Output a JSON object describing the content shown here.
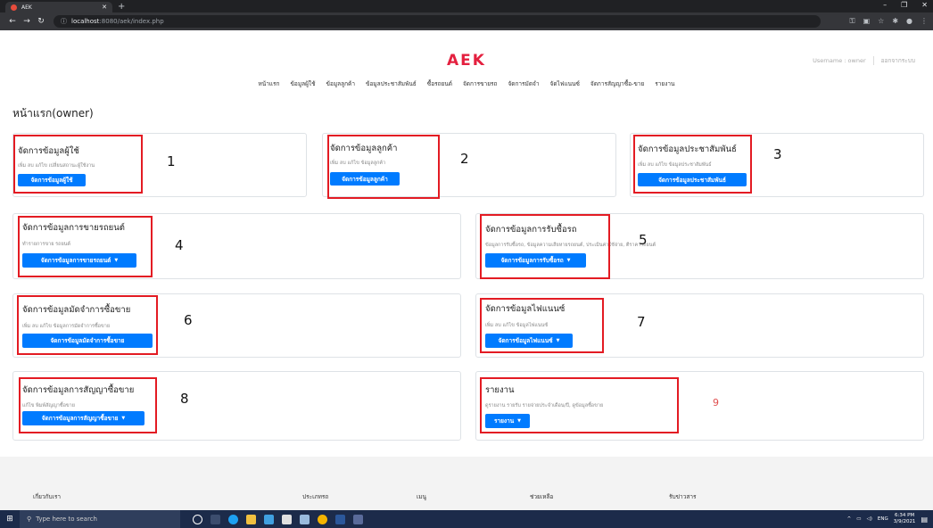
{
  "browser": {
    "tab_title": "AEK",
    "url_host": "localhost",
    "url_rest": ":8080/aek/index.php"
  },
  "header": {
    "brand": "AEK",
    "username": "Username : owner",
    "logout": "ออกจากระบบ"
  },
  "nav": [
    "หน้าแรก",
    "ข้อมูลผู้ใช้",
    "ข้อมูลลูกค้า",
    "ข้อมูลประชาสัมพันธ์",
    "ซื้อรถยนต์",
    "จัดการขายรถ",
    "จัดการมัดจำ",
    "จัดไฟแนนซ์",
    "จัดการสัญญาซื้อ-ขาย",
    "รายงาน"
  ],
  "page_title": "หน้าแรก(owner)",
  "cards": [
    {
      "title": "จัดการข้อมูลผู้ใช้",
      "desc": "เพิ่ม ลบ แก้ไข เปลี่ยนสถานะผู้ใช้งาน",
      "button": "จัดการข้อมูลผู้ใช้",
      "num": "1"
    },
    {
      "title": "จัดการข้อมูลลูกค้า",
      "desc": "เพิ่ม ลบ แก้ไข ข้อมูลลูกค้า",
      "button": "จัดการข้อมูลลูกค้า",
      "num": "2"
    },
    {
      "title": "จัดการข้อมูลประชาสัมพันธ์",
      "desc": "เพิ่ม ลบ แก้ไข ข้อมูลประชาสัมพันธ์",
      "button": "จัดการข้อมูลประชาสัมพันธ์",
      "num": "3"
    },
    {
      "title": "จัดการข้อมูลการขายรถยนต์",
      "desc": "ทำรายการขาย รถยนต์",
      "button": "จัดการข้อมูลการขายรถยนต์",
      "num": "4"
    },
    {
      "title": "จัดการข้อมูลการรับซื้อรถ",
      "desc": "ข้อมูลการรับซื้อรถ, ข้อมูลความเสียหายรถยนต์, ประเมินค่าใช้จ่าย, ตีราคารถยนต์",
      "button": "จัดการข้อมูลการรับซื้อรถ",
      "num": "5"
    },
    {
      "title": "จัดการข้อมูลมัดจำการซื้อขาย",
      "desc": "เพิ่ม ลบ แก้ไข ข้อมูลการมัดจำการซื้อขาย",
      "button": "จัดการข้อมูลมัดจำการซื้อขาย",
      "num": "6"
    },
    {
      "title": "จัดการข้อมูลไฟแนนซ์",
      "desc": "เพิ่ม ลบ แก้ไข ข้อมูลไฟแนนซ์",
      "button": "จัดการข้อมูลไฟแนนซ์",
      "num": "7"
    },
    {
      "title": "จัดการข้อมูลการสัญญาซื้อขาย",
      "desc": "แก้ไข พิมพ์สัญญาซื้อขาย",
      "button": "จัดการข้อมูลการสัญญาซื้อขาย",
      "num": "8"
    },
    {
      "title": "รายงาน",
      "desc": "ดูรายงาน รายรับ รายจ่ายประจำเดือน/ปี, ดูข้อมูลซื้อขาย",
      "button": "รายงาน",
      "num": "9"
    }
  ],
  "footer": [
    "เกี่ยวกับเรา",
    "ประเภทรถ",
    "เมนู",
    "ช่วยเหลือ",
    "รับข่าวสาร"
  ],
  "taskbar": {
    "search": "Type here to search",
    "lang": "ENG",
    "time": "6:34 PM",
    "date": "3/9/2021"
  }
}
